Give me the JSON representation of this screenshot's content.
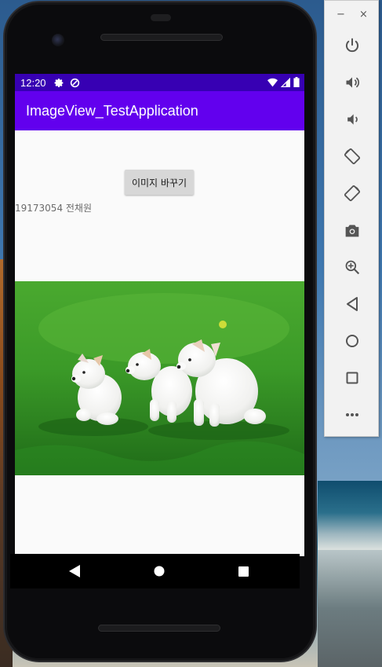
{
  "status_bar": {
    "time": "12:20",
    "icons": [
      "settings-icon",
      "data-saver-icon",
      "wifi-icon",
      "signal-icon",
      "battery-icon"
    ]
  },
  "app_bar": {
    "title": "ImageView_TestApplication"
  },
  "main": {
    "change_image_button": "이미지 바꾸기",
    "caption": "19173054 전채원",
    "image": {
      "subject": "puppies"
    }
  },
  "nav_bar": {
    "icons": [
      "back-icon",
      "home-icon",
      "recents-icon"
    ]
  },
  "emulator_panel": {
    "window_controls": [
      "−",
      "×"
    ],
    "buttons": [
      "power-icon",
      "volume-up-icon",
      "volume-down-icon",
      "rotate-left-icon",
      "rotate-right-icon",
      "camera-icon",
      "zoom-icon",
      "back-icon",
      "home-icon",
      "overview-icon",
      "more-icon"
    ]
  },
  "colors": {
    "status_bar": "#3700b3",
    "app_bar": "#6200ee",
    "background": "#fafafa",
    "button": "#d7d7d7"
  }
}
